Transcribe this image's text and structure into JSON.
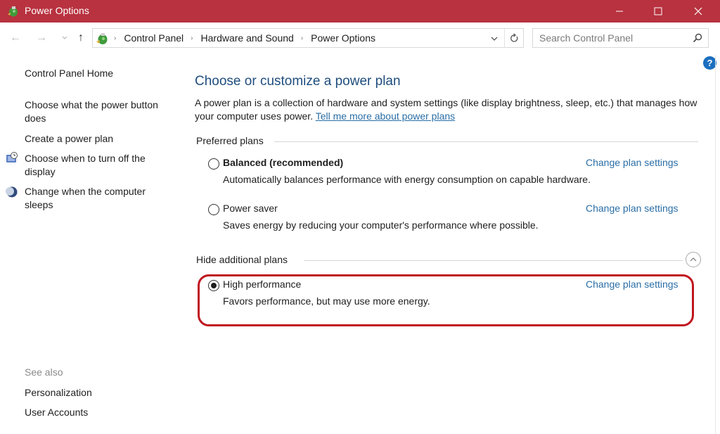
{
  "window": {
    "title": "Power Options",
    "controls": {
      "minimize": "—",
      "maximize": "☐",
      "close": "✕"
    }
  },
  "nav": {
    "back_icon": "←",
    "forward_icon": "→",
    "recent_icon": "⌄",
    "up_icon": "↑",
    "breadcrumb": [
      "Control Panel",
      "Hardware and Sound",
      "Power Options"
    ],
    "separator": "›",
    "dropdown_icon": "⌄",
    "refresh_icon": "↻"
  },
  "search": {
    "placeholder": "Search Control Panel",
    "value": ""
  },
  "help": {
    "icon": "?"
  },
  "sidebar": {
    "home": "Control Panel Home",
    "tasks": [
      {
        "label": "Choose what the power button does",
        "icon": ""
      },
      {
        "label": "Create a power plan",
        "icon": ""
      },
      {
        "label": "Choose when to turn off the display",
        "icon": "display-clock-icon"
      },
      {
        "label": "Change when the computer sleeps",
        "icon": "moon-icon"
      }
    ],
    "see_also_label": "See also",
    "see_also": [
      "Personalization",
      "User Accounts"
    ]
  },
  "main": {
    "title": "Choose or customize a power plan",
    "intro_text": "A power plan is a collection of hardware and system settings (like display brightness, sleep, etc.) that manages how your computer uses power. ",
    "intro_link": "Tell me more about power plans",
    "preferred_label": "Preferred plans",
    "additional_label": "Hide additional plans",
    "collapse_icon": "︿",
    "change_label": "Change plan settings",
    "plans": [
      {
        "name": "Balanced (recommended)",
        "description": "Automatically balances performance with energy consumption on capable hardware.",
        "selected": false,
        "bold": true
      },
      {
        "name": "Power saver",
        "description": "Saves energy by reducing your computer's performance where possible.",
        "selected": false,
        "bold": false
      },
      {
        "name": "High performance",
        "description": "Favors performance, but may use more energy.",
        "selected": true,
        "bold": false
      }
    ]
  },
  "colors": {
    "titlebar": "#b8323f",
    "link": "#2a6ea6",
    "title_text": "#1e4d7e",
    "highlight": "#c0161f"
  }
}
